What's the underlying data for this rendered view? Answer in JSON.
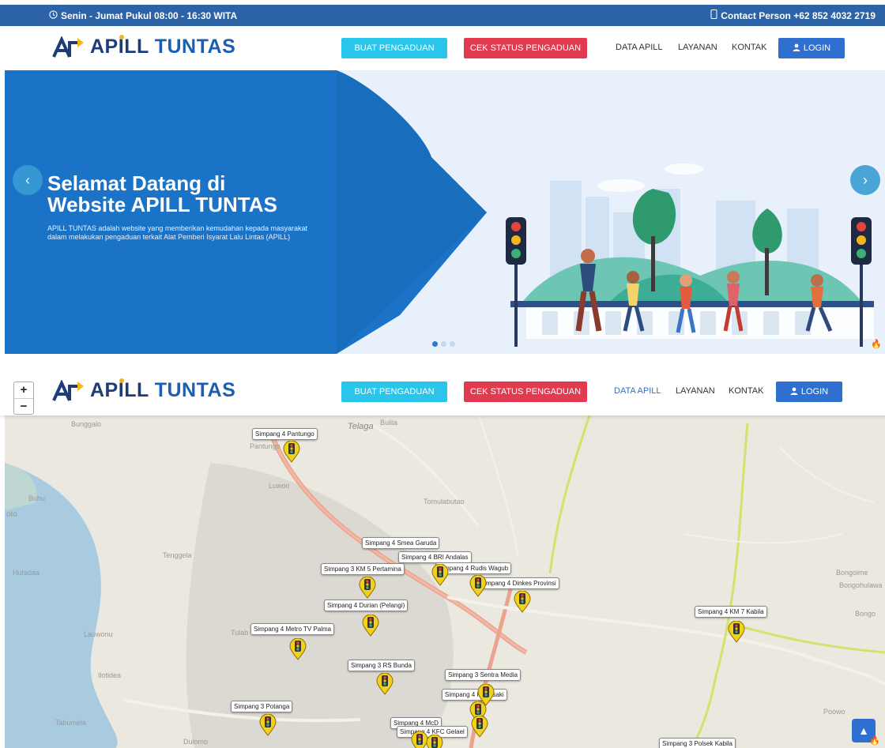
{
  "topbar": {
    "hours": "Senin - Jumat Pukul 08:00 - 16:30 WITA",
    "contact": "Contact Person +62 852 4032 2719"
  },
  "brand": {
    "part1": "AP",
    "part2": "LL",
    "part3": "TUNTAS"
  },
  "nav": {
    "buat": "BUAT PENGADUAN",
    "cek": "CEK STATUS PENGADUAN",
    "data": "DATA APILL",
    "layanan": "LAYANAN",
    "kontak": "KONTAK",
    "login": "LOGIN"
  },
  "hero": {
    "title1": "Selamat Datang di",
    "title2": "Website APILL TUNTAS",
    "desc1": "APILL TUNTAS adalah website yang memberikan kemudahan kepada masyarakat",
    "desc2": "dalam melakukan pengaduan terkait Alat Pemberi Isyarat Lalu Lintas (APILL)",
    "slides": 3,
    "active_slide": 1
  },
  "zoom": {
    "plus": "+",
    "minus": "−"
  },
  "map_places": {
    "bunggalo": "Bunggalo",
    "telaga": "Telaga",
    "bulila": "Bulila",
    "pantungo": "Pantungo",
    "luwoo": "Luwoo",
    "tomulabutao": "Tomulabutao",
    "buhu": "Buhu",
    "oto": "oto",
    "tenggela": "Tenggela",
    "hutadaa": "Hutadaa",
    "lauwonu": "Lauwonu",
    "ilotidea": "Ilotidea",
    "tulab": "Tulab",
    "tabumela": "Tabumela",
    "dulomo": "Dulomo",
    "bongoime": "Bongoime",
    "bongohulawa": "Bongohulawa",
    "bongo": "Bongo",
    "poowo": "Poowo"
  },
  "markers": [
    "Simpang 4 Pantungo",
    "Simpang 4 Smea Garuda",
    "Simpang 4 BRI Andalas",
    "Simpang 3 KM 5 Pertamina",
    "Simpang 4 Rudis Wagub",
    "Simpang 4 Dinkes Provinsi",
    "Simpang 4 Durian (Pelangi)",
    "Simpang 4 Metro TV Palma",
    "Simpang 4 KM 7 Kabila",
    "Simpang 3 RS Bunda",
    "Simpang 3 Sentra Media",
    "Simpang 4 Kawasaki",
    "Simpang 3 Potanga",
    "Simpang 4 McD",
    "Simpang 4 KFC Gelael",
    "Simpang 3 Polsek Kabila"
  ],
  "colors": {
    "topbar": "#2c63a6",
    "buat": "#29c5eb",
    "cek": "#e23a4f",
    "login": "#2f6fd0",
    "hero_blue": "#1a73c6"
  }
}
